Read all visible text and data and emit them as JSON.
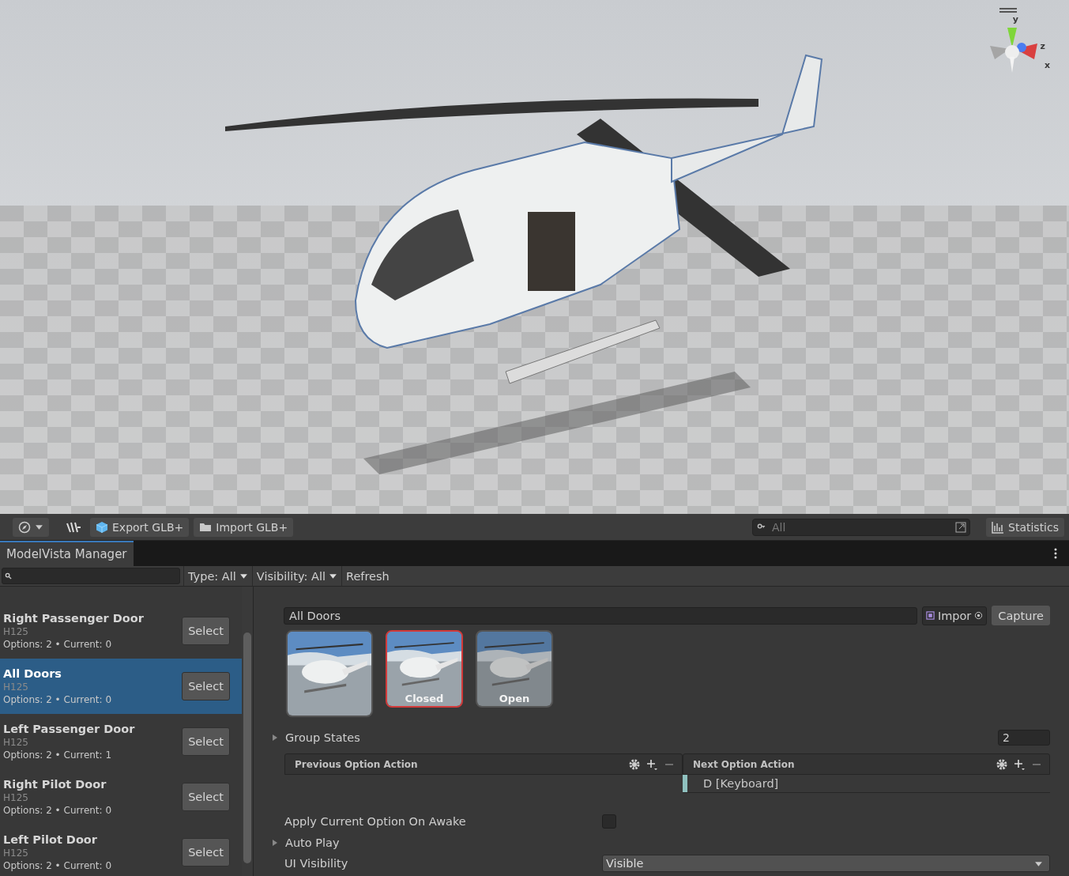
{
  "scene": {
    "gizmo_axes": [
      {
        "label": "y",
        "kind": "y"
      },
      {
        "label": "z",
        "kind": "z"
      },
      {
        "label": "x",
        "kind": "x"
      }
    ]
  },
  "toolbar": {
    "export_button": "Export GLB+",
    "import_button": "Import GLB+",
    "search": {
      "placeholder": "All"
    },
    "statistics_button": "Statistics"
  },
  "window_tab": {
    "title": "ModelVista Manager",
    "selected": true
  },
  "filters": {
    "type": "Type: All",
    "visibility": "Visibility: All",
    "refresh": "Refresh"
  },
  "groups": [
    {
      "name": "Right Passenger Door",
      "model": "H125",
      "info": "Options: 2 • Current: 0",
      "selected": false,
      "button": "Select"
    },
    {
      "name": "All Doors",
      "model": "H125",
      "info": "Options: 2 • Current: 0",
      "selected": true,
      "button": "Select"
    },
    {
      "name": "Left Passenger Door",
      "model": "H125",
      "info": "Options: 2 • Current: 1",
      "selected": false,
      "button": "Select"
    },
    {
      "name": "Right Pilot Door",
      "model": "H125",
      "info": "Options: 2 • Current: 0",
      "selected": false,
      "button": "Select"
    },
    {
      "name": "Left Pilot Door",
      "model": "H125",
      "info": "Options: 2 • Current: 0",
      "selected": false,
      "button": "Select"
    }
  ],
  "detail": {
    "name": "All Doors",
    "import_button": "Impor",
    "capture_button": "Capture",
    "options": [
      {
        "label": "Closed",
        "selected": true
      },
      {
        "label": "Open",
        "selected": false
      }
    ],
    "group_states": {
      "label": "Group States",
      "expanded": false,
      "count": "2"
    },
    "actions": [
      {
        "title": "Previous Option Action"
      },
      {
        "title": "Next Option Action",
        "bindings": [
          "D [Keyboard]"
        ]
      }
    ],
    "apply_on_awake": {
      "label": "Apply Current Option On Awake",
      "checked": false
    },
    "auto_play": {
      "label": "Auto Play",
      "expanded": false
    },
    "ui_visibility": {
      "label": "UI Visibility",
      "value": "Visible"
    }
  }
}
